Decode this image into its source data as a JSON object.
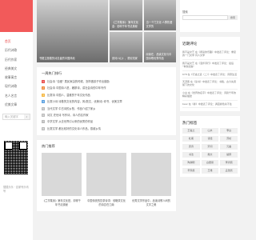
{
  "sidebar": {
    "nav": [
      {
        "label": "首页",
        "active": true
      },
      {
        "label": "历代诗歌"
      },
      {
        "label": "历代作家"
      },
      {
        "label": "经典美文"
      },
      {
        "label": "故事寓言"
      },
      {
        "label": "现代诗歌"
      },
      {
        "label": "名人名言"
      },
      {
        "label": "优美文章"
      }
    ],
    "search_placeholder": "输入关键字",
    "search_icon": "search-icon",
    "footer": "搜狐乐乐 · 百家号乐讯号"
  },
  "hero": {
    "big_caption": "书籍主题楼的诗意盎然中国风地",
    "tiles": [
      "《兰亭集序》 第年文化金：影响千年书法奥秘",
      "当一个门文化·人群热爱文学的",
      "张问川心》，重民知家",
      "阅读在，品读文化与中国诗歌优秀作品"
    ]
  },
  "ranking": {
    "title": "一周热门排行",
    "items": [
      {
        "num": "1",
        "color": "#e94d4d",
        "text": "社会诗 \"自爱\" 属民家由的时候，怎样做孩子作出鼓励"
      },
      {
        "num": "2",
        "color": "#f08a3c",
        "text": "社会诗 中国诗人是，著那诗，讲社会诗的中年写作"
      },
      {
        "num": "3",
        "color": "#f5b843",
        "text": "比赛诗 中国人，温雅的千年文化作品"
      },
      {
        "num": "4",
        "color": "#5aa0e0",
        "text": "比赛小诗 诗基的文化的内容，风(散文，优美诗) 你书、优美文章"
      },
      {
        "num": "5",
        "color": "#bbbbbb",
        "text": "当代文学 中古诗的乡愁、作品介绍了家乡"
      },
      {
        "num": "6",
        "color": "#bbbbbb",
        "text": "诗文 史世诗 写作诗，诗人的名作家"
      },
      {
        "num": "7",
        "color": "#bbbbbb",
        "text": "中学文学 从去世界引以来的优秀的作品"
      },
      {
        "num": "8",
        "color": "#bbbbbb",
        "text": "比赛文学 都比较好的文化诗人作品，感谢乡情"
      }
    ]
  },
  "recommend": {
    "title": "热门推荐",
    "items": [
      "《兰亭集序》第年文化是，却得千年书法奥秘",
      "中国传统的饮茶诗词：领略茶文化的诗意在江南",
      "优秀文学作品中，品读诗歌人间的文字之美"
    ]
  },
  "right": {
    "search_label": "搜索",
    "search_button": "搜索",
    "comments_title": "近期评论",
    "comments": [
      "我不是文艺 在《阅读的乐趣》中发表了评论：重复的一门文学 同人文学",
      "我不是文艺 在《漫步诗行》中发表了评论：最后 \"青秋如霜\"",
      "KY8 在《行进之道（二）》中发表了评论：诗意生活",
      "天涯客 在《读书》中发表了评论：书籍，古今先贤留下的文化",
      "小白 在《世界的名字》中发表了评论：诗篇千年的精彩描述",
      "bear 在《春》中发表了评论：满园春色关不住"
    ],
    "tags_title": "热门标签",
    "tags": [
      "王羲之",
      "山水",
      "李白",
      "杜甫",
      "诗经",
      "苏轼",
      "唐诗",
      "宋词",
      "元曲",
      "书法",
      "散文",
      "楚辞",
      "陶渊明",
      "白居易",
      "李清照",
      "辛弃疾",
      "王维",
      "孟浩然"
    ]
  }
}
